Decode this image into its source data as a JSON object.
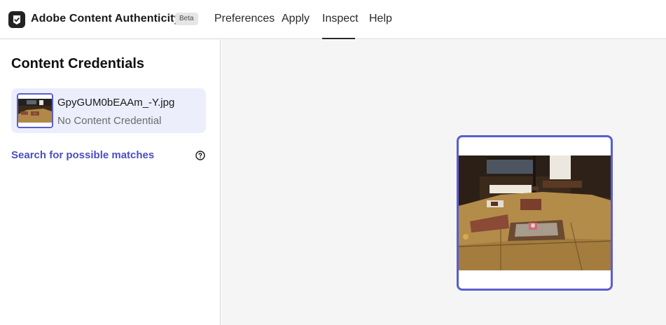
{
  "header": {
    "app_title": "Adobe Content Authenticity",
    "beta_badge": "Beta",
    "nav": [
      {
        "label": "Preferences"
      },
      {
        "label": "Apply"
      },
      {
        "label": "Inspect",
        "active": true
      },
      {
        "label": "Help"
      }
    ]
  },
  "sidebar": {
    "title": "Content Credentials",
    "file": {
      "name": "GpyGUM0bEAAm_-Y.jpg",
      "status": "No Content Credential"
    },
    "search_link": "Search for possible matches",
    "help_icon": "question-circle-icon"
  },
  "colors": {
    "accent": "#5a5ed0",
    "link": "#4b4fc0",
    "card_bg": "#eceefc",
    "main_bg": "#f5f5f5"
  }
}
